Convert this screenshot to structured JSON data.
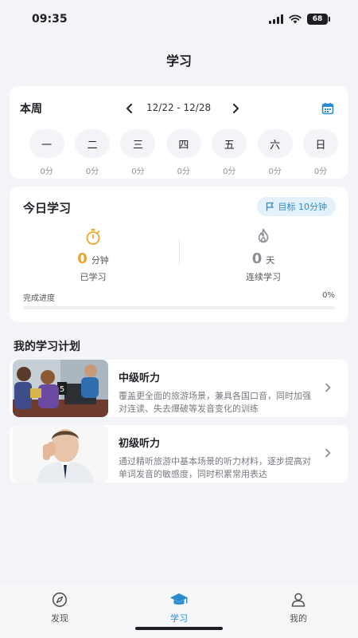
{
  "status_bar": {
    "time": "09:35",
    "battery": "68"
  },
  "header": {
    "title": "学习"
  },
  "week": {
    "label": "本周",
    "range": "12/22 - 12/28",
    "prev_icon": "chevron-left-icon",
    "next_icon": "chevron-right-icon",
    "calendar_icon": "calendar-icon",
    "days": [
      {
        "name": "一",
        "minutes": "0分"
      },
      {
        "name": "二",
        "minutes": "0分"
      },
      {
        "name": "三",
        "minutes": "0分"
      },
      {
        "name": "四",
        "minutes": "0分"
      },
      {
        "name": "五",
        "minutes": "0分"
      },
      {
        "name": "六",
        "minutes": "0分"
      },
      {
        "name": "日",
        "minutes": "0分"
      }
    ]
  },
  "today": {
    "title": "今日学习",
    "goal": "目标 10分钟",
    "studied": {
      "value": "0",
      "unit": "分钟",
      "caption": "已学习"
    },
    "streak": {
      "value": "0",
      "unit": "天",
      "caption": "连续学习"
    },
    "progress_label": "完成进度",
    "progress_text": "0%",
    "progress_fraction": 0
  },
  "plans": {
    "title": "我的学习计划",
    "items": [
      {
        "title": "中级听力",
        "desc": "覆盖更全面的旅游场景，兼具各国口音，同时加强对连读、失去爆破等发音变化的训练"
      },
      {
        "title": "初级听力",
        "desc": "通过精听旅游中基本场景的听力材料，逐步提高对单词发音的敏感度，同时积累常用表达"
      }
    ]
  },
  "tabs": [
    {
      "label": "发现",
      "icon": "compass-icon"
    },
    {
      "label": "学习",
      "icon": "graduation-cap-icon"
    },
    {
      "label": "我的",
      "icon": "user-icon"
    }
  ],
  "colors": {
    "accent": "#2a8bd0",
    "streak": "#8a8f96",
    "timer": "#f0a52a",
    "progress_value": "#f0a52a"
  }
}
